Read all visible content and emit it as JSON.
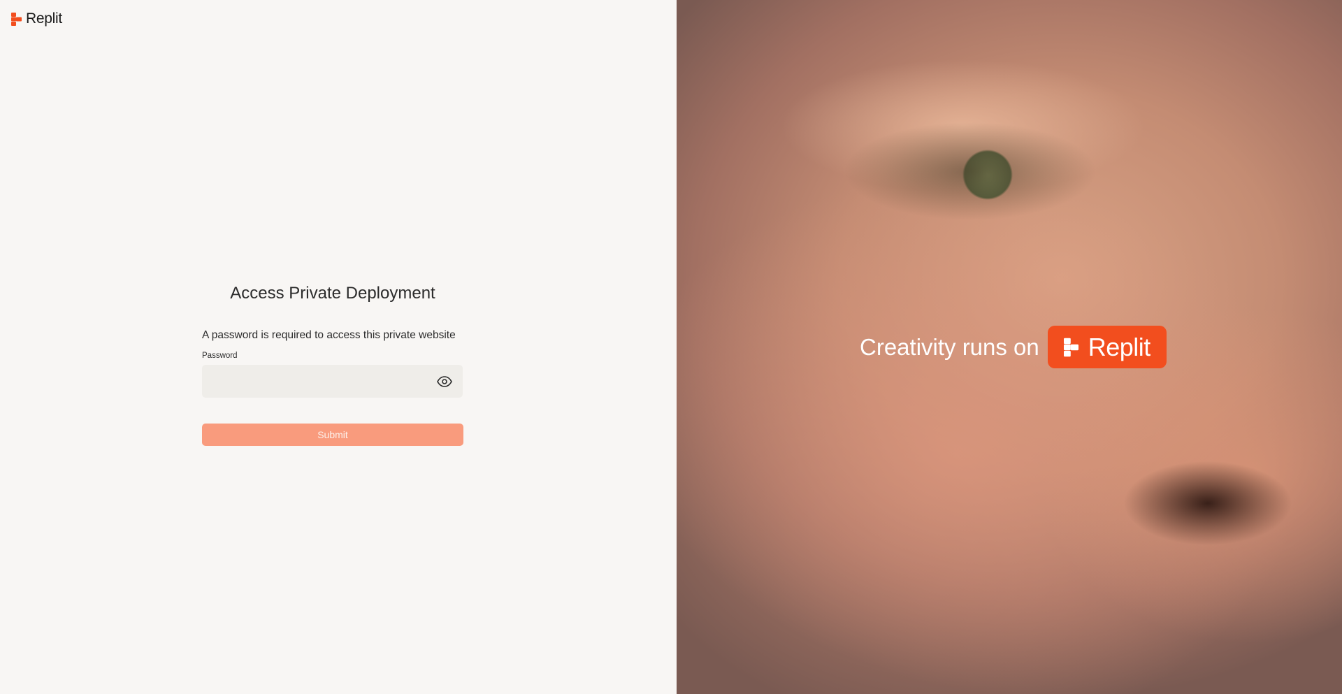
{
  "brand": {
    "name": "Replit",
    "accent_color": "#f24e1e",
    "logo_icon": "replit-logo-icon"
  },
  "form": {
    "title": "Access Private Deployment",
    "description": "A password is required to access this private website",
    "password_label": "Password",
    "password_value": "",
    "password_placeholder": "",
    "show_password_icon": "eye-icon",
    "submit_label": "Submit",
    "submit_color": "#f99b7d"
  },
  "hero": {
    "tagline": "Creativity runs on",
    "badge_text": "Replit",
    "badge_color": "#f24e1e"
  }
}
